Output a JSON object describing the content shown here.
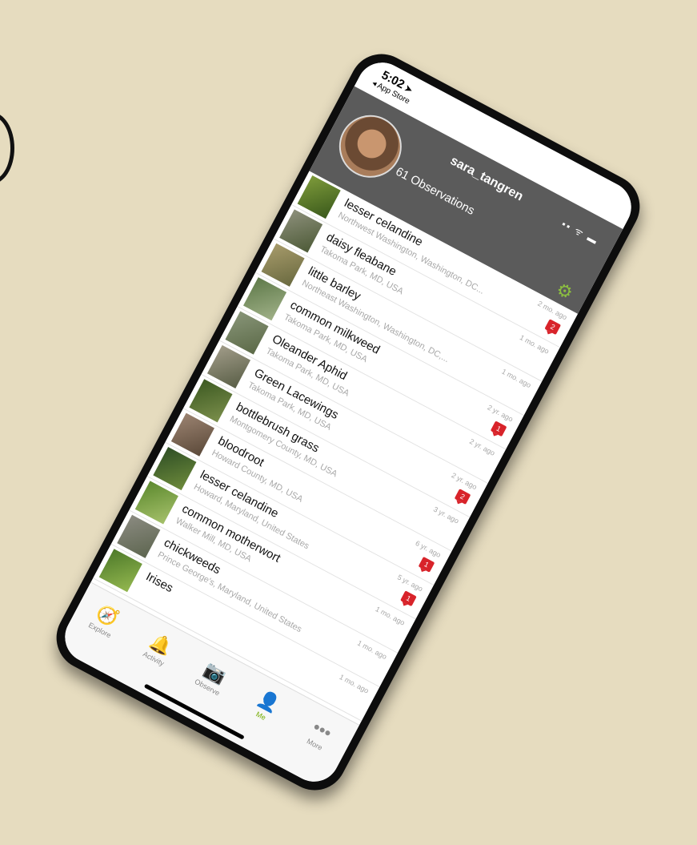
{
  "status_bar": {
    "time": "5:02",
    "back_label": "◂ App Store",
    "icons": "▪▪ ᯤ ▬"
  },
  "profile": {
    "username": "sara_tangren",
    "observation_count": "61 Observations"
  },
  "observations": [
    {
      "name": "lesser celandine",
      "place": "Northwest Washington, Washington, DC...",
      "age": "2 mo. ago",
      "comments": "2"
    },
    {
      "name": "daisy fleabane",
      "place": "Takoma Park, MD, USA",
      "age": "1 mo. ago",
      "comments": ""
    },
    {
      "name": "little barley",
      "place": "Northeast Washington, Washington, DC,...",
      "age": "1 mo. ago",
      "comments": ""
    },
    {
      "name": "common milkweed",
      "place": "Takoma Park, MD, USA",
      "age": "2 yr. ago",
      "comments": "1"
    },
    {
      "name": "Oleander Aphid",
      "place": "Takoma Park, MD, USA",
      "age": "2 yr. ago",
      "comments": ""
    },
    {
      "name": "Green Lacewings",
      "place": "Takoma Park, MD, USA",
      "age": "2 yr. ago",
      "comments": "2"
    },
    {
      "name": "bottlebrush grass",
      "place": "Montgomery County, MD, USA",
      "age": "3 yr. ago",
      "comments": ""
    },
    {
      "name": "bloodroot",
      "place": "Howard County, MD, USA",
      "age": "6 yr. ago",
      "comments": "1"
    },
    {
      "name": "lesser celandine",
      "place": "Howard, Maryland, United States",
      "age": "5 yr. ago",
      "comments": "1"
    },
    {
      "name": "common motherwort",
      "place": "Walker Mill, MD, USA",
      "age": "1 mo. ago",
      "comments": ""
    },
    {
      "name": "chickweeds",
      "place": "Prince George's, Maryland, United States",
      "age": "1 mo. ago",
      "comments": ""
    },
    {
      "name": "Irises",
      "place": "",
      "age": "1 mo. ago",
      "comments": ""
    }
  ],
  "tabs": [
    {
      "label": "Explore",
      "icon": "compass-icon",
      "glyph": "🧭"
    },
    {
      "label": "Activity",
      "icon": "bell-icon",
      "glyph": "🔔"
    },
    {
      "label": "Observe",
      "icon": "camera-icon",
      "glyph": "📷"
    },
    {
      "label": "Me",
      "icon": "person-icon",
      "glyph": "👤"
    },
    {
      "label": "More",
      "icon": "more-icon",
      "glyph": "•••"
    }
  ],
  "colors": {
    "background": "#e6dcbf",
    "header": "#5b5b5b",
    "accent": "#74ac00",
    "badge": "#d8232a"
  }
}
